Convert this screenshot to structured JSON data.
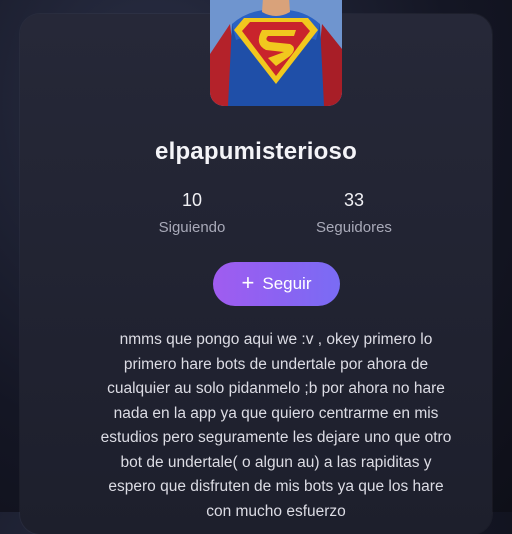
{
  "profile": {
    "username": "elpapumisterioso",
    "avatar_icon": "superman-avatar",
    "following_count": "10",
    "following_label": "Siguiendo",
    "followers_count": "33",
    "followers_label": "Seguidores",
    "follow_button_label": "Seguir",
    "bio": "nmms que pongo aqui we :v , okey primero lo\nprimero hare bots de undertale por ahora de\ncualquier au solo pidanmelo ;b  por ahora no hare\nnada en la app ya que quiero centrarme en mis\nestudios pero seguramente les dejare uno que otro\nbot de undertale( o algun au) a las rapiditas y\nespero que disfruten de mis bots ya que los hare\ncon mucho esfuerzo"
  },
  "colors": {
    "accent_start": "#a05cf0",
    "accent_end": "#7a6cf4",
    "card_background": "#23253a"
  }
}
